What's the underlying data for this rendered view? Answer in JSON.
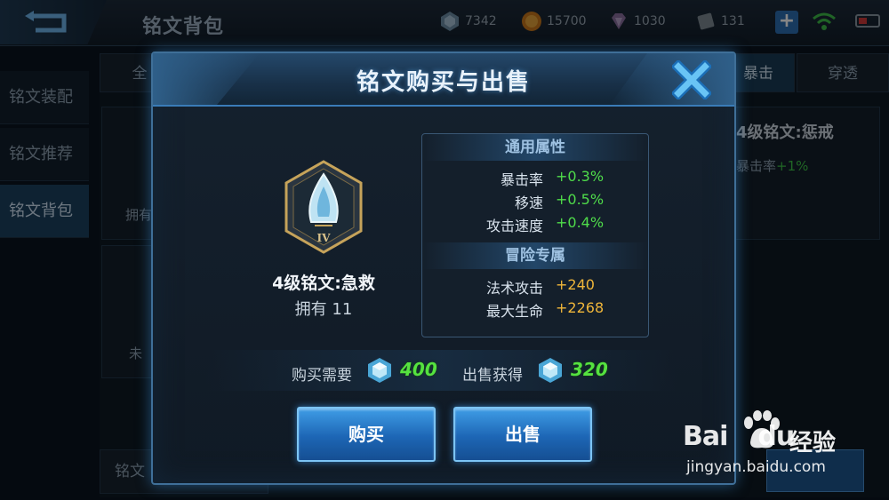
{
  "screen": {
    "title": "铭文背包",
    "currencies": [
      {
        "icon": "blue-crystal-icon",
        "value": "7342"
      },
      {
        "icon": "gold-coin-icon",
        "value": "15700"
      },
      {
        "icon": "purple-diamond-icon",
        "value": "1030"
      },
      {
        "icon": "scroll-ticket-icon",
        "value": "131"
      }
    ],
    "plus": "+",
    "nav": [
      "铭文装配",
      "铭文推荐",
      "铭文背包"
    ],
    "tabs": {
      "first": "全",
      "crit": "暴击",
      "pierce": "穿透"
    },
    "cards": {
      "owned_partial": "拥有",
      "unowned_partial": "未"
    },
    "right_title": "4级铭文:惩戒",
    "right_stat_name": "暴击率",
    "right_stat_val": "+1%",
    "bottom_left": "铭文",
    "bottom_right": ""
  },
  "modal": {
    "title": "铭文购买与出售",
    "rune": {
      "name": "4级铭文:急救",
      "owned": "拥有 11",
      "tier": "IV"
    },
    "sections": {
      "general": "通用属性",
      "adventure": "冒险专属"
    },
    "general_attrs": [
      {
        "name": "暴击率",
        "value": "+0.3%"
      },
      {
        "name": "移速",
        "value": "+0.5%"
      },
      {
        "name": "攻击速度",
        "value": "+0.4%"
      }
    ],
    "adventure_attrs": [
      {
        "name": "法术攻击",
        "value": "+240"
      },
      {
        "name": "最大生命",
        "value": "+2268"
      }
    ],
    "buy_label": "购买需要",
    "buy_price": "400",
    "sell_label": "出售获得",
    "sell_price": "320",
    "buy_button": "购买",
    "sell_button": "出售",
    "colors": {
      "positive": "#4fdc4a",
      "adventure": "#f0b63a",
      "accent": "#3a7cb8"
    }
  },
  "watermark": {
    "logo": "Bai",
    "logo_tail": "du",
    "cn": "经验",
    "url": "jingyan.baidu.com"
  }
}
